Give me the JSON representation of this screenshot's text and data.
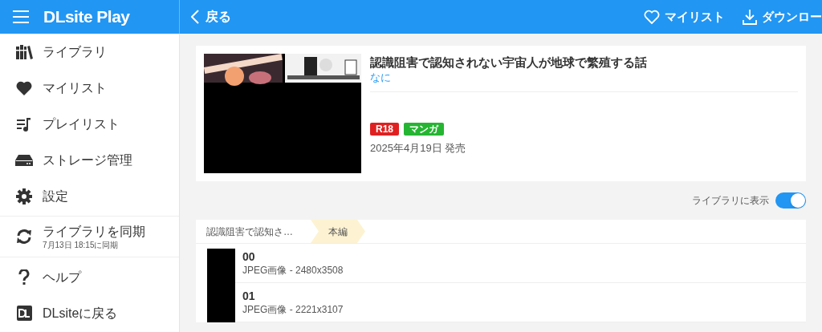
{
  "app": {
    "title": "DLsite Play"
  },
  "sidebar": {
    "items": [
      {
        "label": "ライブラリ"
      },
      {
        "label": "マイリスト"
      },
      {
        "label": "プレイリスト"
      },
      {
        "label": "ストレージ管理"
      },
      {
        "label": "設定"
      },
      {
        "label": "ライブラリを同期",
        "subtitle": "7月13日 18:15に同期"
      },
      {
        "label": "ヘルプ"
      },
      {
        "label": "DLsiteに戻る"
      }
    ]
  },
  "toolbar": {
    "back": "戻る",
    "actions": [
      "マイリスト",
      "ダウンロー"
    ]
  },
  "work": {
    "title": "認識阻害で認知されない宇宙人が地球で繁殖する話",
    "author": "なに",
    "tags": [
      {
        "label": "R18",
        "color": "#e02020"
      },
      {
        "label": "マンガ",
        "color": "#25b532"
      }
    ],
    "release": "2025年4月19日 発売"
  },
  "library_toggle": {
    "label": "ライブラリに表示",
    "on": true
  },
  "breadcrumb": [
    {
      "label": "認識阻害で認知さ…",
      "selected": false
    },
    {
      "label": "本編",
      "selected": true
    }
  ],
  "files": [
    {
      "name": "00",
      "info": "JPEG画像 - 2480x3508"
    },
    {
      "name": "01",
      "info": "JPEG画像 - 2221x3107"
    }
  ]
}
